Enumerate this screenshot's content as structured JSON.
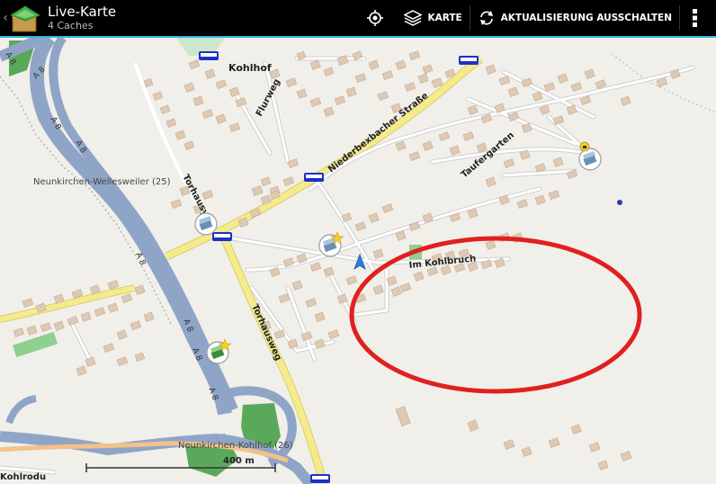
{
  "header": {
    "title": "Live-Karte",
    "subtitle": "4 Caches",
    "map_button_label": "KARTE",
    "refresh_button_label": "AKTUALISIERUNG AUSSCHALTEN"
  },
  "map": {
    "labels": {
      "kohlhof": "Kohlhof",
      "flurweg": "Flurweg",
      "niederbexbacher": "Niederbexbacher Straße",
      "taufergarten": "Taufergarten",
      "torhausy": "Torhausy",
      "torhausweg": "Torhausweg",
      "im_kohlbruch": "Im Kohlbruch",
      "neunkirchen_wellesweiler": "Neunkirchen-Wellesweiler (25)",
      "neunkirchen_kohlhof": "Neunkirchen-Kohlhof (26)",
      "kohlrodung": "Kohlrodu",
      "a8_1": "A 8",
      "a8_2": "A 8",
      "a8_3": "A 8",
      "a8_4": "A 8",
      "a8_5": "A 8",
      "a8_6": "A 8",
      "a8_7": "A 8",
      "a8_8": "A 8"
    },
    "scale_label": "400 m",
    "colors": {
      "motorway": "#8fa5c7",
      "primary_road": "#f5eb8c",
      "building": "#ddc9b4",
      "green": "#8fcf8f",
      "marker_circle": "#e02020",
      "bus_stop": "#1b31c8"
    }
  }
}
